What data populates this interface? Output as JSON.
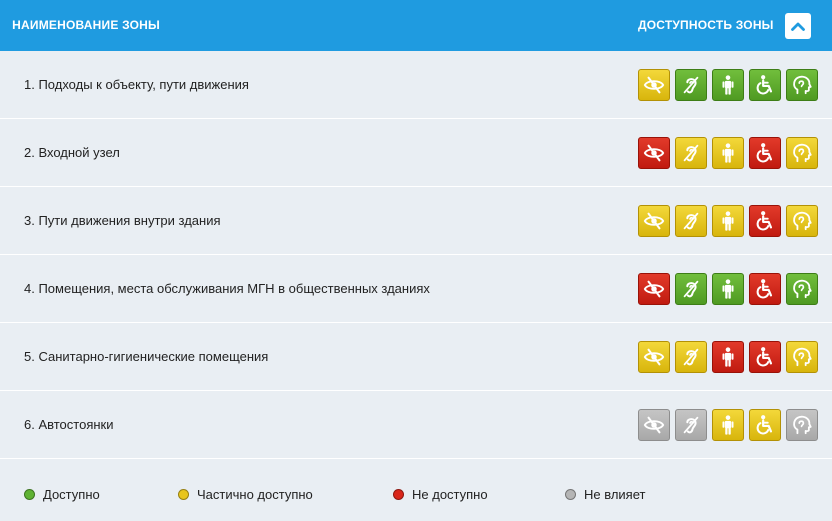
{
  "header": {
    "zone_name_label": "НАИМЕНОВАНИЕ ЗОНЫ",
    "zone_access_label": "ДОСТУПНОСТЬ ЗОНЫ",
    "collapse_icon": "chevron-up-icon"
  },
  "categories": [
    {
      "icon": "vision-icon"
    },
    {
      "icon": "hearing-icon"
    },
    {
      "icon": "person-icon"
    },
    {
      "icon": "wheelchair-icon"
    },
    {
      "icon": "mental-icon"
    }
  ],
  "rows": [
    {
      "label": "1. Подходы к объекту, пути движения",
      "statuses": [
        "yellow",
        "green",
        "green",
        "green",
        "green"
      ]
    },
    {
      "label": "2. Входной узел",
      "statuses": [
        "red",
        "yellow",
        "yellow",
        "red",
        "yellow"
      ]
    },
    {
      "label": "3. Пути движения внутри здания",
      "statuses": [
        "yellow",
        "yellow",
        "yellow",
        "red",
        "yellow"
      ]
    },
    {
      "label": "4. Помещения, места обслуживания МГН в общественных зданиях",
      "statuses": [
        "red",
        "green",
        "green",
        "red",
        "green"
      ]
    },
    {
      "label": "5. Санитарно-гигиенические помещения",
      "statuses": [
        "yellow",
        "yellow",
        "red",
        "red",
        "yellow"
      ]
    },
    {
      "label": "6. Автостоянки",
      "statuses": [
        "gray",
        "gray",
        "yellow",
        "yellow",
        "gray"
      ]
    }
  ],
  "legend": [
    {
      "label": "Доступно",
      "color": "#5fb233"
    },
    {
      "label": "Частично доступно",
      "color": "#e8c51c"
    },
    {
      "label": "Не доступно",
      "color": "#d9261a"
    },
    {
      "label": "Не влияет",
      "color": "#b5b5b5"
    }
  ],
  "colors": {
    "header_bg": "#1f9be0",
    "yellow": "#e8c51c",
    "green": "#5fb233",
    "red": "#d9261a",
    "gray": "#b5b5b5"
  }
}
